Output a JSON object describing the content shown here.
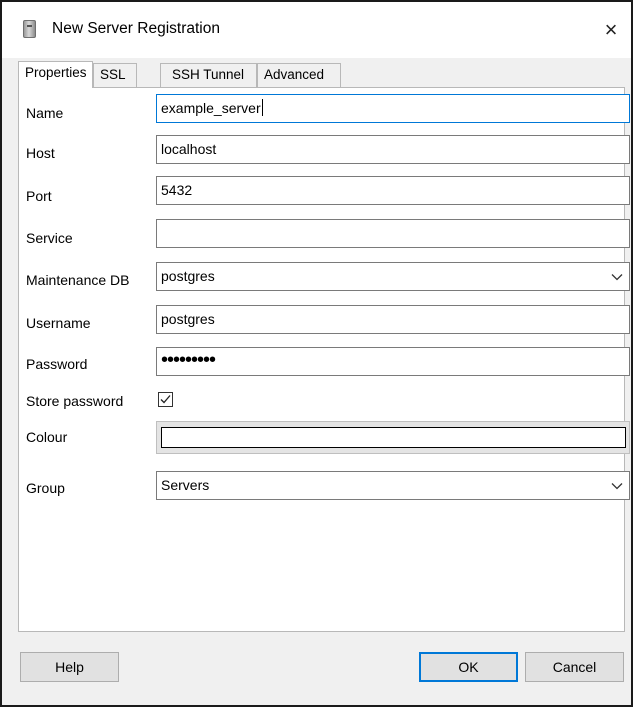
{
  "window": {
    "title": "New Server Registration",
    "close_glyph": "×",
    "icon": "server-icon"
  },
  "tabs": [
    {
      "label": "Properties",
      "active": true
    },
    {
      "label": "SSL",
      "active": false
    },
    {
      "label": "SSH Tunnel",
      "active": false
    },
    {
      "label": "Advanced",
      "active": false
    }
  ],
  "form": {
    "name": {
      "label": "Name",
      "value": "example_server"
    },
    "host": {
      "label": "Host",
      "value": "localhost"
    },
    "port": {
      "label": "Port",
      "value": "5432"
    },
    "service": {
      "label": "Service",
      "value": ""
    },
    "maintenance_db": {
      "label": "Maintenance DB",
      "value": "postgres"
    },
    "username": {
      "label": "Username",
      "value": "postgres"
    },
    "password": {
      "label": "Password",
      "value": "•••••••••"
    },
    "store_password": {
      "label": "Store password",
      "checked": true
    },
    "colour": {
      "label": "Colour",
      "value": "#ffffff"
    },
    "group": {
      "label": "Group",
      "value": "Servers"
    }
  },
  "buttons": {
    "help": "Help",
    "ok": "OK",
    "cancel": "Cancel"
  },
  "colors": {
    "focus_accent": "#0078d7",
    "dialog_bg": "#f0f0f0"
  }
}
